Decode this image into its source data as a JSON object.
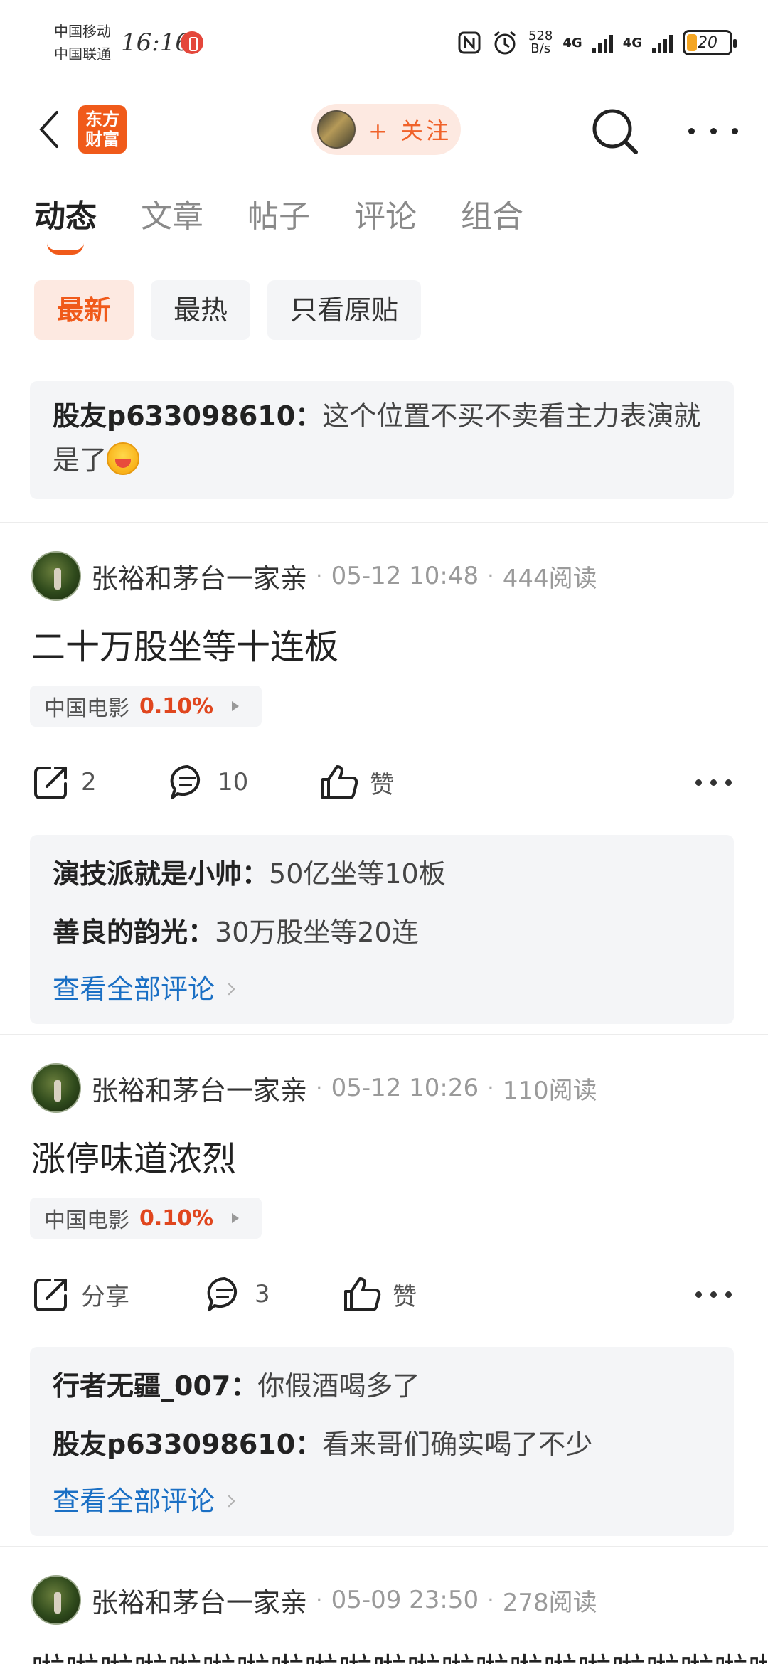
{
  "status_bar": {
    "carrier_1": "中国移动",
    "carrier_2": "中国联通",
    "time": "16:16",
    "speed_value": "528",
    "speed_unit": "B/s",
    "net_1": "4G",
    "net_2": "4G",
    "battery": "20"
  },
  "header": {
    "logo_line1": "东方",
    "logo_line2": "财富",
    "follow_label": "+ 关注"
  },
  "tabs": [
    {
      "label": "动态",
      "active": true
    },
    {
      "label": "文章",
      "active": false
    },
    {
      "label": "帖子",
      "active": false
    },
    {
      "label": "评论",
      "active": false
    },
    {
      "label": "组合",
      "active": false
    }
  ],
  "filters": [
    {
      "label": "最新",
      "active": true
    },
    {
      "label": "最热",
      "active": false
    },
    {
      "label": "只看原贴",
      "active": false
    }
  ],
  "pinned": {
    "user": "股友p633098610",
    "colon": "：",
    "text": "这个位置不买不卖看主力表演就是了"
  },
  "posts": [
    {
      "author": "张裕和茅台一家亲",
      "time": "05-12 10:48",
      "reads": "444阅读",
      "title": "二十万股坐等十连板",
      "stock": {
        "name": "中国电影",
        "pct": "0.10%"
      },
      "share_label": "2",
      "comment_count": "10",
      "like_label": "赞",
      "comments": [
        {
          "user": "演技派就是小帅",
          "text": "50亿坐等10板"
        },
        {
          "user": "善良的韵光",
          "text": "30万股坐等20连"
        }
      ],
      "view_all": "查看全部评论"
    },
    {
      "author": "张裕和茅台一家亲",
      "time": "05-12 10:26",
      "reads": "110阅读",
      "title": "涨停味道浓烈",
      "stock": {
        "name": "中国电影",
        "pct": "0.10%"
      },
      "share_label": "分享",
      "comment_count": "3",
      "like_label": "赞",
      "comments": [
        {
          "user": "行者无疆_007",
          "text": "你假酒喝多了"
        },
        {
          "user": "股友p633098610",
          "text": "看来哥们确实喝了不少"
        }
      ],
      "view_all": "查看全部评论"
    },
    {
      "author": "张裕和茅台一家亲",
      "time": "05-09 23:50",
      "reads": "278阅读",
      "title": "啦啦啦啦啦啦啦啦啦啦啦啦啦啦啦啦啦啦啦啦啦啦"
    }
  ],
  "separator": "·",
  "colon": "：",
  "colors": {
    "accent": "#f05a1a",
    "link": "#1a6fc4",
    "up": "#e0461e",
    "card_bg": "#f4f5f7"
  }
}
